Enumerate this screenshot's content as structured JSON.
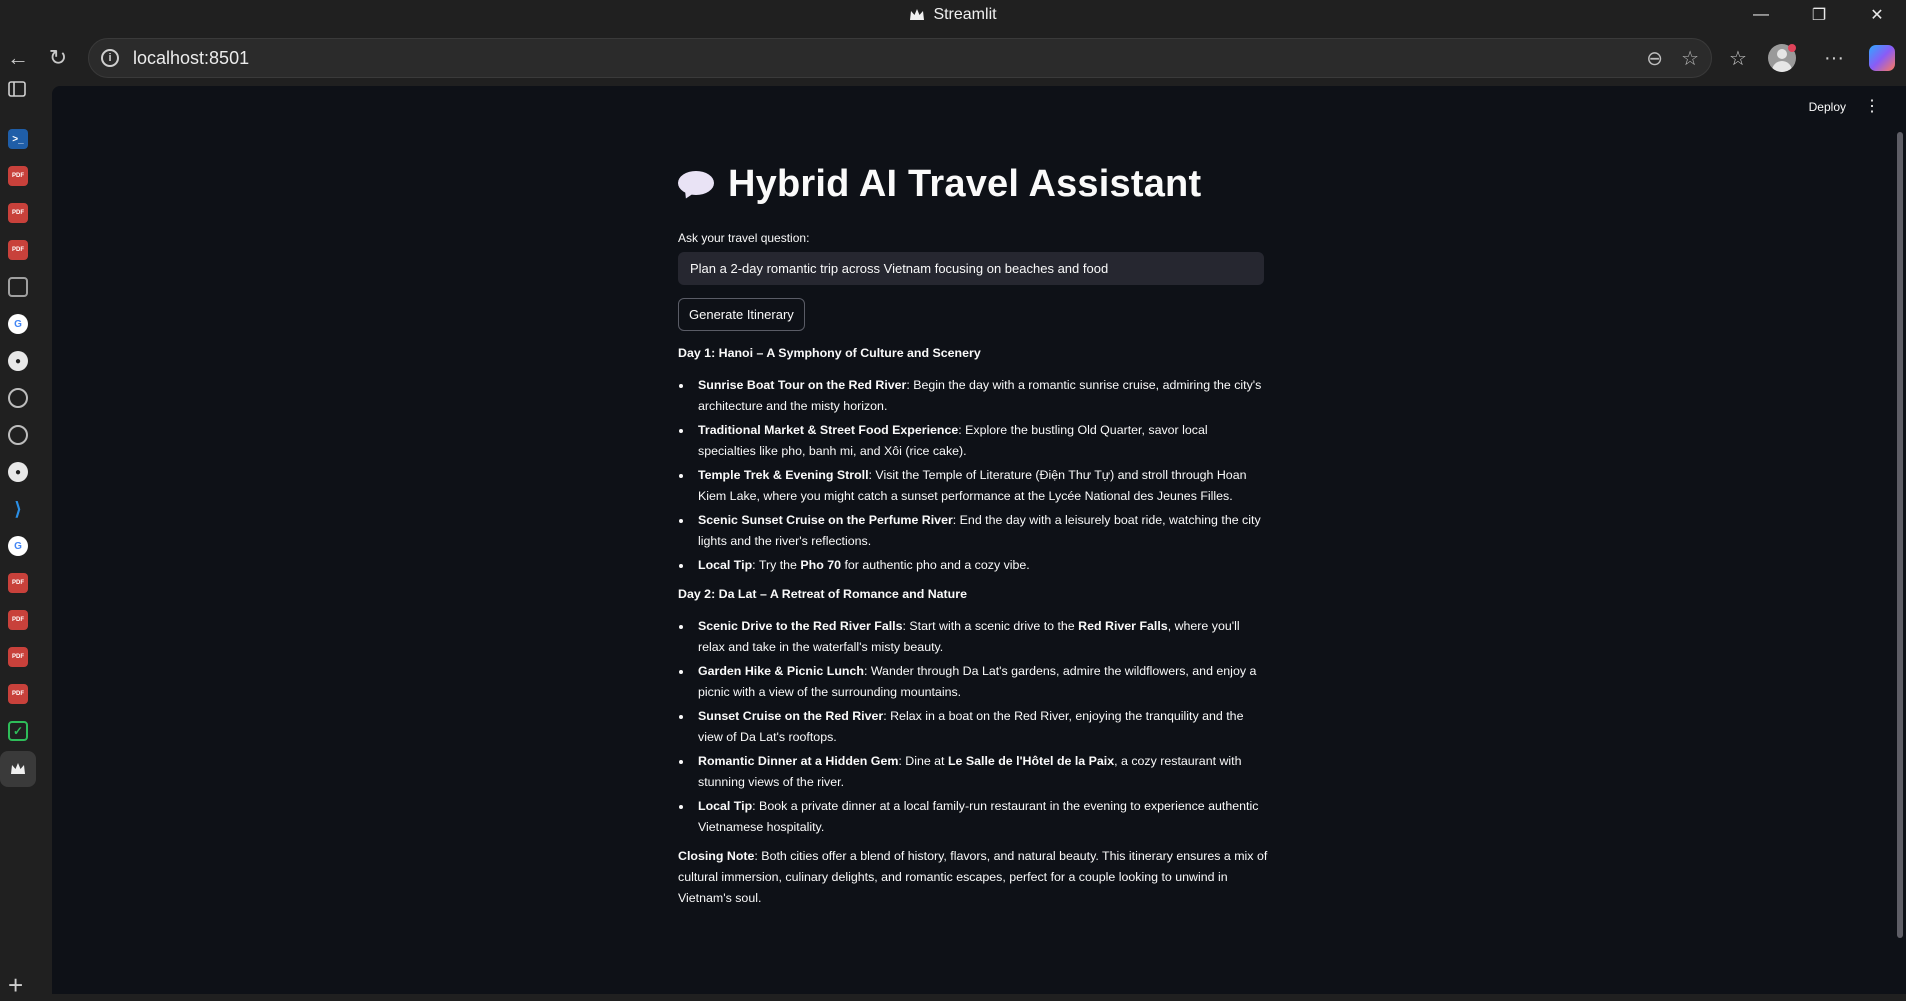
{
  "window": {
    "title": "Streamlit",
    "minimize": "—",
    "restore": "❐",
    "close": "✕"
  },
  "browser": {
    "url": "localhost:8501",
    "back": "←",
    "reload": "↻",
    "zoom_icon": "⊖",
    "star_icon": "☆",
    "favorites_icon": "☆",
    "more_icon": "···"
  },
  "sidebar": {
    "icons": [
      "minus",
      "powershell",
      "pdf",
      "pdf",
      "pdf",
      "file",
      "google",
      "github",
      "chatgpt",
      "globe",
      "github",
      "vscode",
      "google",
      "pdf",
      "pdf",
      "pdf",
      "pdf",
      "checklist",
      "streamlit"
    ],
    "pdf_label": "PDF"
  },
  "app": {
    "deploy_label": "Deploy",
    "menu_label": "⋮",
    "title": "Hybrid AI Travel Assistant",
    "input_label": "Ask your travel question:",
    "input_value": "Plan a 2-day romantic trip across Vietnam focusing on beaches and food",
    "button_label": "Generate Itinerary"
  },
  "itinerary": {
    "day1": {
      "heading": "Day 1: Hanoi – A Symphony of Culture and Scenery",
      "items": [
        {
          "title": "Sunrise Boat Tour on the Red River",
          "text": ": Begin the day with a romantic sunrise cruise, admiring the city's architecture and the misty horizon."
        },
        {
          "title": "Traditional Market & Street Food Experience",
          "text": ": Explore the bustling Old Quarter, savor local specialties like pho, banh mi, and Xôi (rice cake)."
        },
        {
          "title": "Temple Trek & Evening Stroll",
          "text": ": Visit the Temple of Literature (Điện Thư Tự) and stroll through Hoan Kiem Lake, where you might catch a sunset performance at the Lycée National des Jeunes Filles."
        },
        {
          "title": "Scenic Sunset Cruise on the Perfume River",
          "text": ": End the day with a leisurely boat ride, watching the city lights and the river's reflections."
        }
      ],
      "tip_title": "Local Tip",
      "tip_pre": ": Try the ",
      "tip_bold": "Pho 70",
      "tip_post": " for authentic pho and a cozy vibe."
    },
    "day2": {
      "heading": "Day 2: Da Lat – A Retreat of Romance and Nature",
      "drive_title": "Scenic Drive to the Red River Falls",
      "drive_pre": ": Start with a scenic drive to the ",
      "drive_bold": "Red River Falls",
      "drive_post": ", where you'll relax and take in the waterfall's misty beauty.",
      "hike_title": "Garden Hike & Picnic Lunch",
      "hike_text": ": Wander through Da Lat's gardens, admire the wildflowers, and enjoy a picnic with a view of the surrounding mountains.",
      "cruise_title": "Sunset Cruise on the Red River",
      "cruise_text": ": Relax in a boat on the Red River, enjoying the tranquility and the view of Da Lat's rooftops.",
      "dinner_title": "Romantic Dinner at a Hidden Gem",
      "dinner_pre": ": Dine at ",
      "dinner_bold": "Le Salle de l'Hôtel de la Paix",
      "dinner_post": ", a cozy restaurant with stunning views of the river.",
      "tip_title": "Local Tip",
      "tip_text": ": Book a private dinner at a local family-run restaurant in the evening to experience authentic Vietnamese hospitality."
    },
    "closing_title": "Closing Note",
    "closing_text": ": Both cities offer a blend of history, flavors, and natural beauty. This itinerary ensures a mix of cultural immersion, culinary delights, and romantic escapes, perfect for a couple looking to unwind in Vietnam's soul."
  }
}
